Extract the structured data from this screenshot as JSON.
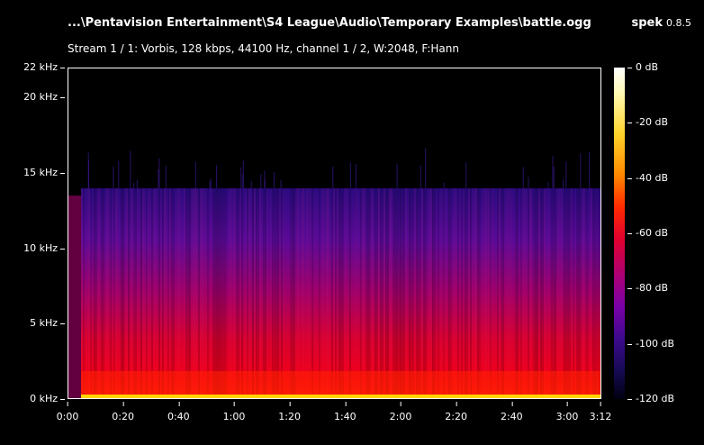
{
  "header": {
    "file_title": "...\\Pentavision Entertainment\\S4 League\\Audio\\Temporary Examples\\battle.ogg",
    "app_name": "spek",
    "app_version": "0.8.5",
    "stream_info": "Stream 1 / 1: Vorbis, 128 kbps, 44100 Hz, channel 1 / 2, W:2048, F:Hann"
  },
  "y_axis": {
    "ticks": [
      {
        "label": "22 kHz",
        "khz": 22
      },
      {
        "label": "20 kHz",
        "khz": 20
      },
      {
        "label": "15 kHz",
        "khz": 15
      },
      {
        "label": "10 kHz",
        "khz": 10
      },
      {
        "label": "5 kHz",
        "khz": 5
      },
      {
        "label": "0 kHz",
        "khz": 0
      }
    ],
    "max_khz": 22
  },
  "x_axis": {
    "ticks": [
      {
        "label": "0:00",
        "sec": 0
      },
      {
        "label": "0:20",
        "sec": 20
      },
      {
        "label": "0:40",
        "sec": 40
      },
      {
        "label": "1:00",
        "sec": 60
      },
      {
        "label": "1:20",
        "sec": 80
      },
      {
        "label": "1:40",
        "sec": 100
      },
      {
        "label": "2:00",
        "sec": 120
      },
      {
        "label": "2:20",
        "sec": 140
      },
      {
        "label": "2:40",
        "sec": 160
      },
      {
        "label": "3:00",
        "sec": 180
      },
      {
        "label": "3:12",
        "sec": 192
      }
    ],
    "max_sec": 192
  },
  "db_scale": {
    "ticks": [
      {
        "label": "0 dB",
        "db": 0
      },
      {
        "label": "-20 dB",
        "db": -20
      },
      {
        "label": "-40 dB",
        "db": -40
      },
      {
        "label": "-60 dB",
        "db": -60
      },
      {
        "label": "-80 dB",
        "db": -80
      },
      {
        "label": "-100 dB",
        "db": -100
      },
      {
        "label": "-120 dB",
        "db": -120
      }
    ],
    "min_db": -120
  },
  "spectrogram": {
    "cutoff_khz": 14,
    "colors": {
      "low": "#2a0a80",
      "mid": "#a0006a",
      "high": "#e8002a",
      "hot": "#ffd400"
    }
  }
}
